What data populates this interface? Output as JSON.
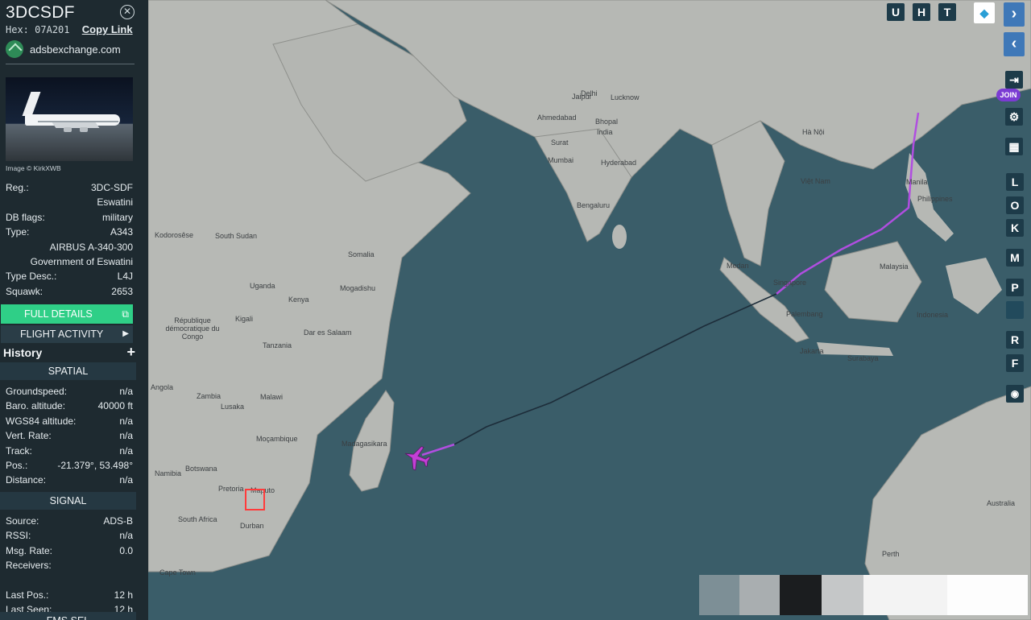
{
  "aircraft": {
    "callsign": "3DCSDF",
    "hex_label": "Hex:",
    "hex": "07A201",
    "copy_link": "Copy Link",
    "site": "adsbexchange.com",
    "photo_credit": "Image © KirkXWB"
  },
  "details": [
    {
      "label": "Reg.:",
      "value": "3DC-SDF"
    },
    {
      "label": "",
      "value": "Eswatini"
    },
    {
      "label": "DB flags:",
      "value": "military"
    },
    {
      "label": "Type:",
      "value": "A343"
    },
    {
      "label": "",
      "value": "AIRBUS A-340-300"
    },
    {
      "label": "",
      "value": "Government of Eswatini"
    },
    {
      "label": "Type Desc.:",
      "value": "L4J"
    },
    {
      "label": "Squawk:",
      "value": "2653"
    }
  ],
  "buttons": {
    "full_details": "FULL DETAILS",
    "flight_activity": "FLIGHT ACTIVITY",
    "history": "History"
  },
  "spatial": {
    "title": "SPATIAL",
    "rows": [
      {
        "label": "Groundspeed:",
        "value": "n/a"
      },
      {
        "label": "Baro. altitude:",
        "value": "40000 ft"
      },
      {
        "label": "WGS84 altitude:",
        "value": "n/a"
      },
      {
        "label": "Vert. Rate:",
        "value": "n/a"
      },
      {
        "label": "Track:",
        "value": "n/a"
      },
      {
        "label": "Pos.:",
        "value": "-21.379°, 53.498°"
      },
      {
        "label": "Distance:",
        "value": "n/a"
      }
    ]
  },
  "signal": {
    "title": "SIGNAL",
    "rows": [
      {
        "label": "Source:",
        "value": "ADS-B"
      },
      {
        "label": "RSSI:",
        "value": "n/a"
      },
      {
        "label": "Msg. Rate:",
        "value": "0.0"
      },
      {
        "label": "Receivers:",
        "value": ""
      },
      {
        "label": "",
        "value": ""
      },
      {
        "label": "Last Pos.:",
        "value": "12 h"
      },
      {
        "label": "Last Seen:",
        "value": "12 h"
      }
    ]
  },
  "next_section": "FMS SEL",
  "controls": {
    "top": [
      "U",
      "H",
      "T"
    ],
    "right": [
      "L",
      "O",
      "K",
      "M",
      "P",
      "R",
      "F"
    ],
    "join": "JOIN"
  },
  "map_labels": [
    {
      "text": "Delhi",
      "kind": "land"
    },
    {
      "text": "Jaipur",
      "kind": "land"
    },
    {
      "text": "Lucknow",
      "kind": "land"
    },
    {
      "text": "Ahmedabad",
      "kind": "land"
    },
    {
      "text": "Bhopal",
      "kind": "land"
    },
    {
      "text": "India",
      "kind": "land"
    },
    {
      "text": "Surat",
      "kind": "land"
    },
    {
      "text": "Mumbai",
      "kind": "land"
    },
    {
      "text": "Hyderabad",
      "kind": "land"
    },
    {
      "text": "Bengaluru",
      "kind": "land"
    },
    {
      "text": "Kenya",
      "kind": "land"
    },
    {
      "text": "Uganda",
      "kind": "land"
    },
    {
      "text": "South Sudan",
      "kind": "land"
    },
    {
      "text": "Somalia",
      "kind": "land"
    },
    {
      "text": "Mogadishu",
      "kind": "land"
    },
    {
      "text": "Kigali",
      "kind": "land"
    },
    {
      "text": "Dar es Salaam",
      "kind": "land"
    },
    {
      "text": "Tanzania",
      "kind": "land"
    },
    {
      "text": "Angola",
      "kind": "land"
    },
    {
      "text": "Zambia",
      "kind": "land"
    },
    {
      "text": "Lusaka",
      "kind": "land"
    },
    {
      "text": "Malawi",
      "kind": "land"
    },
    {
      "text": "Moçambique",
      "kind": "land"
    },
    {
      "text": "Botswana",
      "kind": "land"
    },
    {
      "text": "Pretoria",
      "kind": "land"
    },
    {
      "text": "Maputo",
      "kind": "land"
    },
    {
      "text": "South Africa",
      "kind": "land"
    },
    {
      "text": "Durban",
      "kind": "land"
    },
    {
      "text": "Madagasikara",
      "kind": "land"
    },
    {
      "text": "Kodorosêse",
      "kind": "land"
    },
    {
      "text": "République démocratique du Congo",
      "kind": "land"
    },
    {
      "text": "Medan",
      "kind": "land"
    },
    {
      "text": "Singapore",
      "kind": "land"
    },
    {
      "text": "Palembang",
      "kind": "land"
    },
    {
      "text": "Jakarta",
      "kind": "land"
    },
    {
      "text": "Surabaya",
      "kind": "land"
    },
    {
      "text": "Indonesia",
      "kind": "land"
    },
    {
      "text": "Malaysia",
      "kind": "land"
    },
    {
      "text": "Manila",
      "kind": "land"
    },
    {
      "text": "Philippines",
      "kind": "land"
    },
    {
      "text": "Hà Nội",
      "kind": "land"
    },
    {
      "text": "Việt Nam",
      "kind": "land"
    },
    {
      "text": "Australia",
      "kind": "land"
    },
    {
      "text": "Perth",
      "kind": "land"
    },
    {
      "text": "Namibia",
      "kind": "land"
    },
    {
      "text": "Cape Town",
      "kind": "land"
    }
  ],
  "colors": {
    "sidebar_bg": "#1e2a30",
    "accent_green": "#2fcf87",
    "track_purple": "#b04ee0",
    "track_dark": "#1d2d3a",
    "selected_marker": "#ff3b3b",
    "control_bg": "#1d3b49",
    "nav_blue": "#3f78b8",
    "join_purple": "#7b3bd3"
  }
}
